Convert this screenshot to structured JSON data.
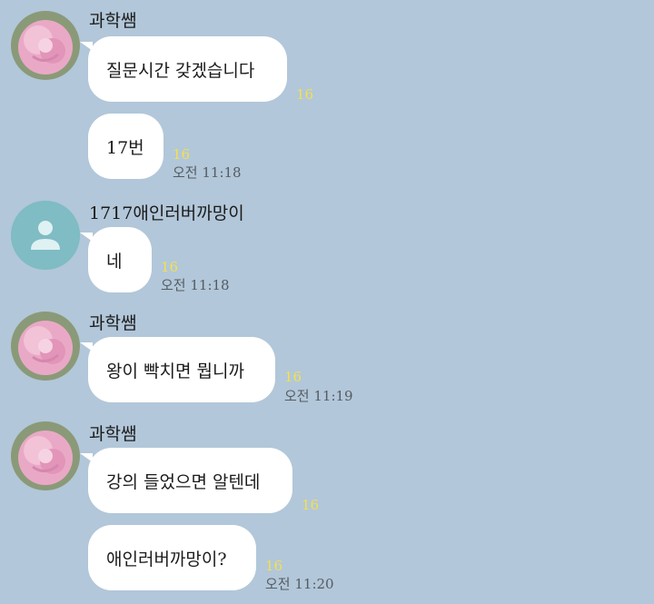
{
  "colors": {
    "background": "#b2c7d9",
    "bubble": "#ffffff",
    "unread": "#f4e04d",
    "time": "#555c63",
    "default_avatar": "#7fbcc4"
  },
  "groups": [
    {
      "sender": "과학쌤",
      "avatar": "pink-rose-photo",
      "messages": [
        {
          "text": "질문시간 갖겠습니다",
          "unread": "16",
          "time": ""
        },
        {
          "text": "17번",
          "unread": "16",
          "time": "오전 11:18"
        }
      ]
    },
    {
      "sender": "1717애인러버까망이",
      "avatar": "default-person-icon",
      "messages": [
        {
          "text": "네",
          "unread": "16",
          "time": "오전 11:18"
        }
      ]
    },
    {
      "sender": "과학쌤",
      "avatar": "pink-rose-photo",
      "messages": [
        {
          "text": "왕이 빡치면 뭡니까",
          "unread": "16",
          "time": "오전 11:19"
        }
      ]
    },
    {
      "sender": "과학쌤",
      "avatar": "pink-rose-photo",
      "messages": [
        {
          "text": "강의 들었으면 알텐데",
          "unread": "16",
          "time": ""
        },
        {
          "text": "애인러버까망이?",
          "unread": "16",
          "time": "오전 11:20"
        }
      ]
    }
  ]
}
